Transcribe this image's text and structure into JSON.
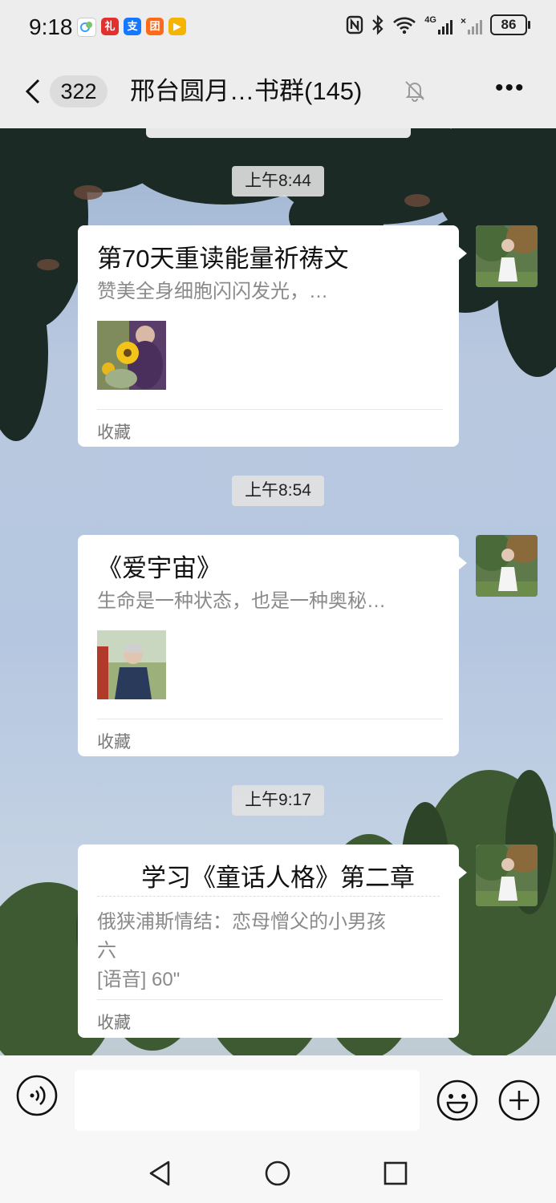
{
  "status_bar": {
    "time": "9:18",
    "battery": "86",
    "network": "4G",
    "apps": [
      {
        "name": "weather-app",
        "color": "#3aa0ff"
      },
      {
        "name": "gift-app",
        "color": "#e0312f"
      },
      {
        "name": "alipay-app",
        "color": "#1677ff"
      },
      {
        "name": "meituan-app",
        "color": "#ff6a1a"
      },
      {
        "name": "video-app",
        "color": "#f4b400"
      }
    ]
  },
  "nav": {
    "unread_count": "322",
    "title": "邢台圆月…书群(145)"
  },
  "messages": [
    {
      "timestamp": "上午8:44",
      "title": "第70天重读能量祈祷文",
      "desc": "赞美全身细胞闪闪发光，…",
      "footer": "收藏"
    },
    {
      "timestamp": "上午8:54",
      "title": "《爱宇宙》",
      "desc": "生命是一种状态，也是一种奥秘…",
      "footer": "收藏"
    },
    {
      "timestamp": "上午9:17",
      "title": "学习《童话人格》第二章",
      "desc_line1": "俄狭浦斯情结：恋母憎父的小男孩",
      "desc_line2": "六",
      "desc_line3": "[语音] 60\"",
      "footer": "收藏"
    }
  ],
  "input": {
    "placeholder": ""
  },
  "colors": {
    "background": "#ededed",
    "bubble": "#ffffff",
    "timestamp_bg": "#e1e1e1"
  }
}
